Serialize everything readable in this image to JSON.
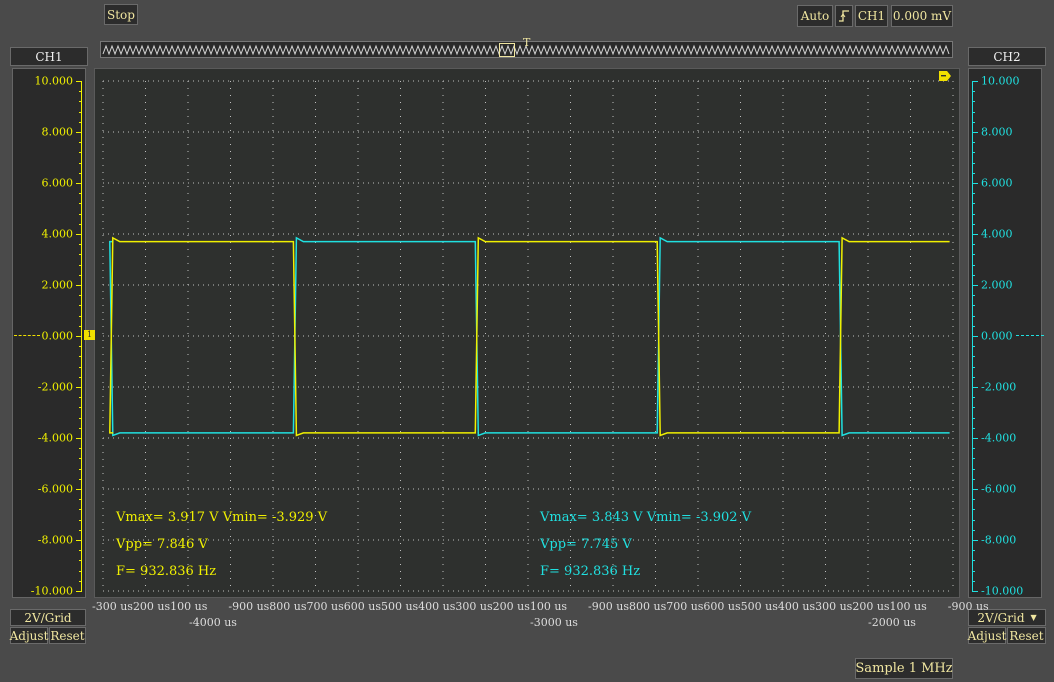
{
  "toolbar": {
    "stop_label": "Stop",
    "mode_label": "Auto",
    "trigger_source": "CH1",
    "trigger_level": "0.000 mV"
  },
  "channels": {
    "ch1": {
      "name": "CH1",
      "color": "#f0f000",
      "axis_labels": [
        "10.000",
        "8.000",
        "6.000",
        "4.000",
        "2.000",
        "0.000",
        "-2.000",
        "-4.000",
        "-6.000",
        "-8.000",
        "-10.000"
      ],
      "scale": "2V/Grid",
      "adjust_label": "Adjust",
      "reset_label": "Reset",
      "measurements": {
        "vmax_vmin": "Vmax= 3.917 V  Vmin= -3.929 V",
        "vpp": "Vpp= 7.846 V",
        "freq": "F= 932.836 Hz"
      }
    },
    "ch2": {
      "name": "CH2",
      "color": "#20e0e0",
      "axis_labels": [
        "10.000",
        "8.000",
        "6.000",
        "4.000",
        "2.000",
        "0.000",
        "-2.000",
        "-4.000",
        "-6.000",
        "-8.000",
        "-10.000"
      ],
      "scale": "2V/Grid",
      "adjust_label": "Adjust",
      "reset_label": "Reset",
      "measurements": {
        "vmax_vmin": "Vmax= 3.843 V  Vmin= -3.902 V",
        "vpp": "Vpp= 7.745 V",
        "freq": "F= 932.836 Hz"
      }
    }
  },
  "time_axis": {
    "ticks_row1": "-300 us200 us100 us      -900 us800 us700 us600 us500 us400 us300 us200 us100 us      -900 us800 us700 us600 us500 us400 us300 us200 us100 us      -900 us",
    "group_labels": [
      "-4000 us",
      "-3000 us",
      "-2000 us"
    ]
  },
  "status": {
    "sample_rate": "Sample 1 MHz"
  },
  "waveforms": {
    "ch1_high_v": 3.7,
    "ch1_low_v": -3.8,
    "ch2_high_v": 3.7,
    "ch2_low_v": -3.8,
    "frequency_hz": 932.836,
    "ch1_edge_times_us": [
      -4330,
      -3790,
      -3255,
      -2720,
      -2185
    ],
    "ch1_first_level": "low",
    "ch2_first_level": "high",
    "time_window_us": [
      -4350,
      -1850
    ],
    "volt_range": [
      -10,
      10
    ]
  }
}
